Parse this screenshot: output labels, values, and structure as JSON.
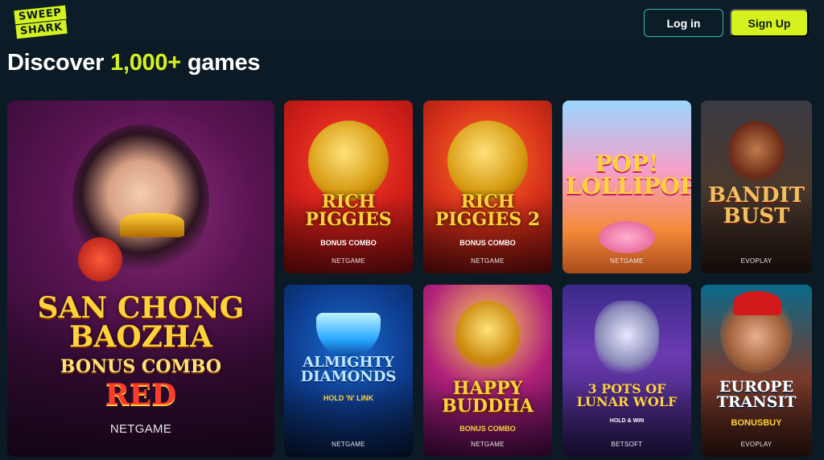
{
  "header": {
    "logo": {
      "line1": "SWEEP",
      "line2": "SHARK"
    },
    "login_label": "Log in",
    "signup_label": "Sign Up"
  },
  "headline": {
    "prefix": "Discover",
    "highlight": "1,000+",
    "suffix": "games"
  },
  "featured": {
    "title": "SAN CHONG BAOZHA",
    "subtitle": "BONUS COMBO",
    "variant": "RED",
    "provider": "NETGAME"
  },
  "games": [
    {
      "title": "RICH PIGGIES",
      "subtitle": "BONUS COMBO",
      "provider": "NETGAME"
    },
    {
      "title": "RICH PIGGIES 2",
      "subtitle": "BONUS COMBO",
      "provider": "NETGAME"
    },
    {
      "title": "POP! LOLLIPOP",
      "subtitle": "",
      "provider": "NETGAME"
    },
    {
      "title": "BANDIT BUST",
      "subtitle": "",
      "provider": "EVOPLAY"
    },
    {
      "title": "ALMIGHTY DIAMONDS",
      "subtitle": "HOLD 'N' LINK",
      "provider": "NETGAME"
    },
    {
      "title": "HAPPY BUDDHA",
      "subtitle": "BONUS COMBO",
      "provider": "NETGAME"
    },
    {
      "title": "3 POTS OF LUNAR WOLF",
      "subtitle": "HOLD & WIN",
      "provider": "BETSOFT"
    },
    {
      "title": "EUROPE TRANSIT",
      "subtitle": "BONUSBUY",
      "provider": "EVOPLAY"
    }
  ],
  "colors": {
    "background": "#0b1a24",
    "accent": "#d6f21e",
    "login_border": "#2fb9b3"
  }
}
